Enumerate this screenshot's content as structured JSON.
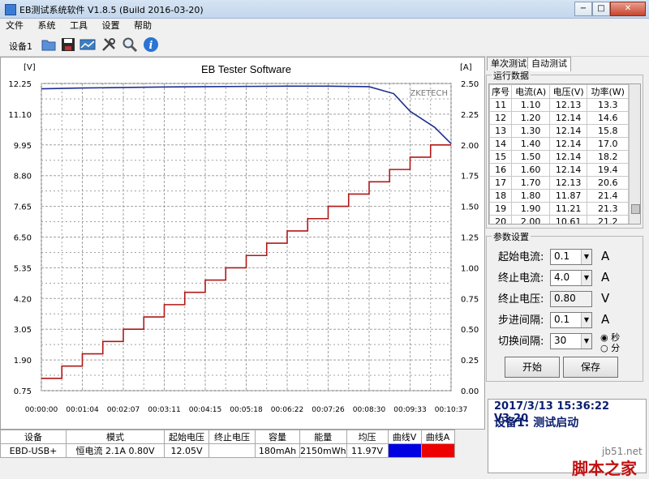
{
  "window": {
    "title": "EB测试系统软件 V1.8.5 (Build 2016-03-20)",
    "min": "−",
    "max": "□",
    "close": "✕"
  },
  "menu": [
    "文件",
    "系统",
    "工具",
    "设置",
    "帮助"
  ],
  "toolbar": {
    "device_label": "设备1",
    "icons": [
      "folder-open-icon",
      "save-icon",
      "chart-icon",
      "tools-icon",
      "search-icon",
      "info-icon"
    ]
  },
  "chart_data": {
    "type": "line",
    "title": "EB Tester Software",
    "watermark": "ZKETECH",
    "left_unit": "[V]",
    "right_unit": "[A]",
    "y_left": {
      "min": 0.75,
      "max": 12.25,
      "ticks": [
        "12.25",
        "11.10",
        "9.95",
        "8.80",
        "7.65",
        "6.50",
        "5.35",
        "4.20",
        "3.05",
        "1.90",
        "0.75"
      ]
    },
    "y_right": {
      "min": 0.0,
      "max": 2.5,
      "ticks": [
        "2.50",
        "2.25",
        "2.00",
        "1.75",
        "1.50",
        "1.25",
        "1.00",
        "0.75",
        "0.50",
        "0.25",
        "0.00"
      ]
    },
    "x_ticks": [
      "00:00:00",
      "00:01:04",
      "00:02:07",
      "00:03:11",
      "00:04:15",
      "00:05:18",
      "00:06:22",
      "00:07:26",
      "00:08:30",
      "00:09:33",
      "00:10:37"
    ],
    "series": [
      {
        "axis": "left",
        "color": "#1f2f8f",
        "x": [
          0,
          1,
          2,
          3,
          4,
          5,
          6,
          7,
          8,
          8.6,
          9,
          9.6,
          10.0
        ],
        "y": [
          12.05,
          12.08,
          12.1,
          12.12,
          12.13,
          12.14,
          12.15,
          12.15,
          12.13,
          11.87,
          11.21,
          10.61,
          10.0
        ]
      },
      {
        "axis": "right",
        "color": "#b01818",
        "step": true,
        "x": [
          0,
          0.5,
          1,
          1.5,
          2,
          2.5,
          3,
          3.5,
          4,
          4.5,
          5,
          5.5,
          6,
          6.5,
          7,
          7.5,
          8,
          8.5,
          9,
          9.5,
          10.0
        ],
        "y": [
          0.1,
          0.2,
          0.3,
          0.4,
          0.5,
          0.6,
          0.7,
          0.8,
          0.9,
          1.0,
          1.1,
          1.2,
          1.3,
          1.4,
          1.5,
          1.6,
          1.7,
          1.8,
          1.9,
          2.0,
          2.0
        ]
      }
    ]
  },
  "right": {
    "tabs": [
      "单次测试",
      "自动测试"
    ],
    "run_group": "运行数据",
    "run_headers": [
      "序号",
      "电流(A)",
      "电压(V)",
      "功率(W)"
    ],
    "run_rows": [
      [
        "11",
        "1.10",
        "12.13",
        "13.3"
      ],
      [
        "12",
        "1.20",
        "12.14",
        "14.6"
      ],
      [
        "13",
        "1.30",
        "12.14",
        "15.8"
      ],
      [
        "14",
        "1.40",
        "12.14",
        "17.0"
      ],
      [
        "15",
        "1.50",
        "12.14",
        "18.2"
      ],
      [
        "16",
        "1.60",
        "12.14",
        "19.4"
      ],
      [
        "17",
        "1.70",
        "12.13",
        "20.6"
      ],
      [
        "18",
        "1.80",
        "11.87",
        "21.4"
      ],
      [
        "19",
        "1.90",
        "11.21",
        "21.3"
      ],
      [
        "20",
        "2.00",
        "10.61",
        "21.2"
      ]
    ],
    "param_group": "参数设置",
    "params": [
      {
        "label": "起始电流:",
        "value": "0.1",
        "unit": "A"
      },
      {
        "label": "终止电流:",
        "value": "4.0",
        "unit": "A"
      },
      {
        "label": "终止电压:",
        "value": "0.80",
        "unit": "V"
      },
      {
        "label": "步进间隔:",
        "value": "0.1",
        "unit": "A"
      },
      {
        "label": "切换间隔:",
        "value": "30",
        "unit": ""
      }
    ],
    "radio_sec": "秒",
    "radio_min": "分",
    "start_button": "开始",
    "save_button": "保存",
    "status_line1": "2017/3/13 15:36:22  V3.20",
    "status_line2": "设备1: 测试启动"
  },
  "bottom": {
    "headers": [
      "设备",
      "模式",
      "起始电压",
      "终止电压",
      "容量",
      "能量",
      "均压",
      "曲线V",
      "曲线A"
    ],
    "row": [
      "EBD-USB+",
      "恒电流 2.1A 0.80V",
      "12.05V",
      "",
      "180mAh",
      "2150mWh",
      "11.97V",
      "",
      ""
    ],
    "curve_v_color": "#0000e0",
    "curve_a_color": "#ee0000"
  },
  "watermark": {
    "url": "jb51.net",
    "cn": "脚本之家"
  }
}
